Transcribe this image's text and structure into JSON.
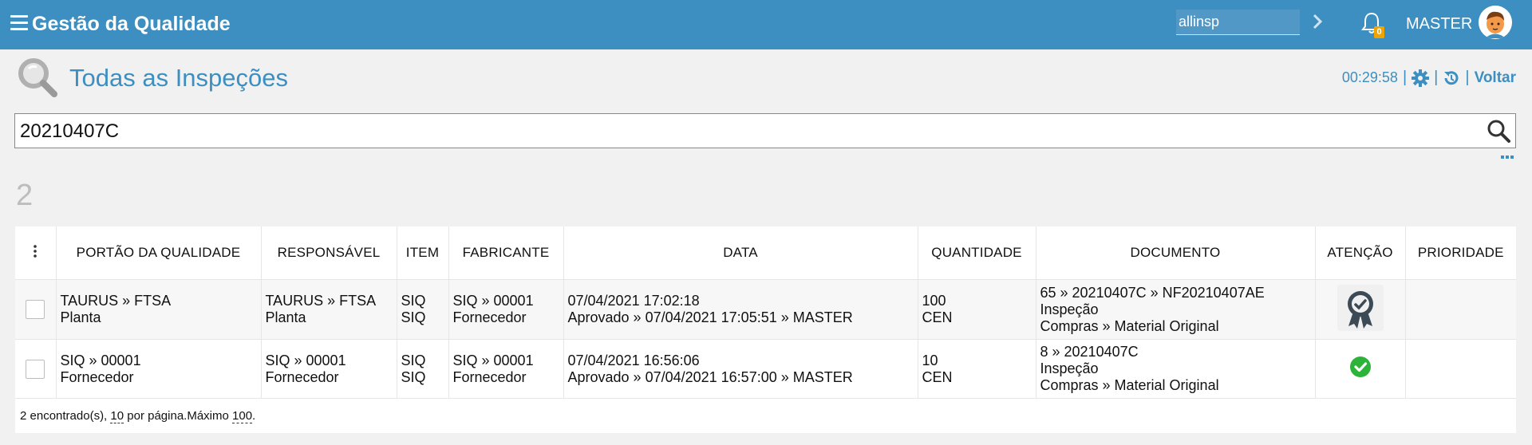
{
  "topbar": {
    "title": "Gestão da Qualidade",
    "search_value": "allinsp",
    "notification_count": "0",
    "user": "MASTER"
  },
  "header": {
    "title": "Todas as Inspeções",
    "timer": "00:29:58",
    "back_label": "Voltar"
  },
  "search": {
    "value": "20210407C"
  },
  "result_count": "2",
  "table": {
    "columns": [
      "PORTÃO DA QUALIDADE",
      "RESPONSÁVEL",
      "ITEM",
      "FABRICANTE",
      "DATA",
      "QUANTIDADE",
      "DOCUMENTO",
      "ATENÇÃO",
      "PRIORIDADE"
    ],
    "rows": [
      {
        "gate": [
          "TAURUS » FTSA",
          "Planta"
        ],
        "responsible": [
          "TAURUS » FTSA",
          "Planta"
        ],
        "item": [
          "SIQ",
          "SIQ"
        ],
        "manufacturer": [
          "SIQ » 00001",
          "Fornecedor"
        ],
        "date": [
          "07/04/2021 17:02:18",
          "Aprovado » 07/04/2021 17:05:51 » MASTER"
        ],
        "quantity": [
          "100",
          "CEN"
        ],
        "document": [
          "65 » 20210407C » NF20210407AE",
          "Inspeção",
          "Compras » Material Original"
        ],
        "attention_icon": "award-badge-icon",
        "priority": ""
      },
      {
        "gate": [
          "SIQ » 00001",
          "Fornecedor"
        ],
        "responsible": [
          "SIQ » 00001",
          "Fornecedor"
        ],
        "item": [
          "SIQ",
          "SIQ"
        ],
        "manufacturer": [
          "SIQ » 00001",
          "Fornecedor"
        ],
        "date": [
          "07/04/2021 16:56:06",
          "Aprovado » 07/04/2021 16:57:00 » MASTER"
        ],
        "quantity": [
          "10",
          "CEN"
        ],
        "document": [
          "8 » 20210407C",
          "Inspeção",
          "Compras » Material Original"
        ],
        "attention_icon": "check-circle-icon",
        "priority": ""
      }
    ],
    "footer": {
      "found": "2 encontrado(s),",
      "per_page": "10",
      "per_page_label": "por página.Máximo",
      "max": "100",
      "end": "."
    }
  },
  "colors": {
    "topbar": "#3d8fc1",
    "success": "#2eb33a",
    "badge": "#f0a400"
  }
}
